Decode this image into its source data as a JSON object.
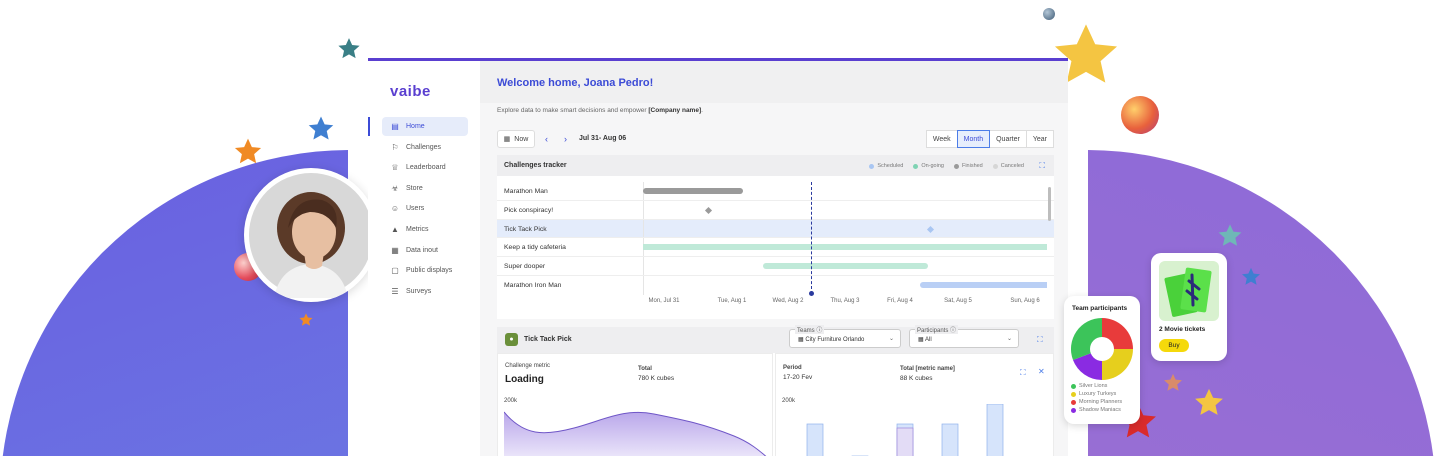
{
  "brand": {
    "logo": "vaibe",
    "accent": "#3c4bd6"
  },
  "sidebar": {
    "items": [
      {
        "label": "Home",
        "icon": "clipboard-icon",
        "active": true
      },
      {
        "label": "Challenges",
        "icon": "person-flag-icon",
        "active": false
      },
      {
        "label": "Leaderboard",
        "icon": "crown-icon",
        "active": false
      },
      {
        "label": "Store",
        "icon": "cart-icon",
        "active": false
      },
      {
        "label": "Users",
        "icon": "users-icon",
        "active": false
      },
      {
        "label": "Metrics",
        "icon": "metrics-icon",
        "active": false
      },
      {
        "label": "Data inout",
        "icon": "table-icon",
        "active": false
      },
      {
        "label": "Public displays",
        "icon": "display-icon",
        "active": false
      },
      {
        "label": "Surveys",
        "icon": "survey-icon",
        "active": false
      }
    ]
  },
  "header": {
    "welcome": "Welcome home, Joana Pedro!",
    "explore": "Explore data to make smart decisions and empower ",
    "explore_bold": "[Company name]",
    "explore_end": "."
  },
  "toolbar": {
    "now_label": "Now",
    "date_range": "Jul 31- Aug 06",
    "periods": [
      {
        "label": "Week",
        "active": false
      },
      {
        "label": "Month",
        "active": true
      },
      {
        "label": "Quarter",
        "active": false
      },
      {
        "label": "Year",
        "active": false
      }
    ]
  },
  "tracker": {
    "title": "Challenges tracker",
    "legend": [
      {
        "label": "Scheduled",
        "color": "#a9c6f2"
      },
      {
        "label": "On-going",
        "color": "#7fd3b3"
      },
      {
        "label": "Finished",
        "color": "#9a9a9a"
      },
      {
        "label": "Canceled",
        "color": "#d6d6d6"
      }
    ],
    "rows": [
      {
        "label": "Marathon Man",
        "highlight": false
      },
      {
        "label": "Pick conspiracy!",
        "highlight": false
      },
      {
        "label": "Tick Tack Pick",
        "highlight": true
      },
      {
        "label": "Keep a tidy cafeteria",
        "highlight": false
      },
      {
        "label": "Super dooper",
        "highlight": false
      },
      {
        "label": "Marathon Iron Man",
        "highlight": false
      }
    ],
    "dates": [
      "Mon, Jul 31",
      "Tue, Aug 1",
      "Wed, Aug 2",
      "Thu, Aug 3",
      "Fri, Aug 4",
      "Sat, Aug 5",
      "Sun, Aug 6"
    ]
  },
  "detail": {
    "title": "Tick Tack Pick",
    "teams_caption": "Teams",
    "teams_value": "City Furniture Orlando",
    "participants_caption": "Participants",
    "participants_value": "All",
    "left": {
      "metric_label": "Challenge metric",
      "metric_value": "Loading",
      "total_label": "Total",
      "total_value": "780 K cubes",
      "axis_top": "200k"
    },
    "right": {
      "period_label": "Period",
      "period_value": "17-20 Fev",
      "total_label": "Total [metric name]",
      "total_value": "88 K cubes",
      "axis_top": "200k"
    }
  },
  "team_card": {
    "title": "Team participants",
    "teams": [
      {
        "label": "Silver Lions",
        "color": "#3cc45a"
      },
      {
        "label": "Luxury Turkeys",
        "color": "#e6cf1d"
      },
      {
        "label": "Morning Planners",
        "color": "#e83b3b"
      },
      {
        "label": "Shadow Maniacs",
        "color": "#8a2be2"
      }
    ]
  },
  "reward_card": {
    "name": "2 Movie tickets",
    "buy_label": "Buy"
  }
}
